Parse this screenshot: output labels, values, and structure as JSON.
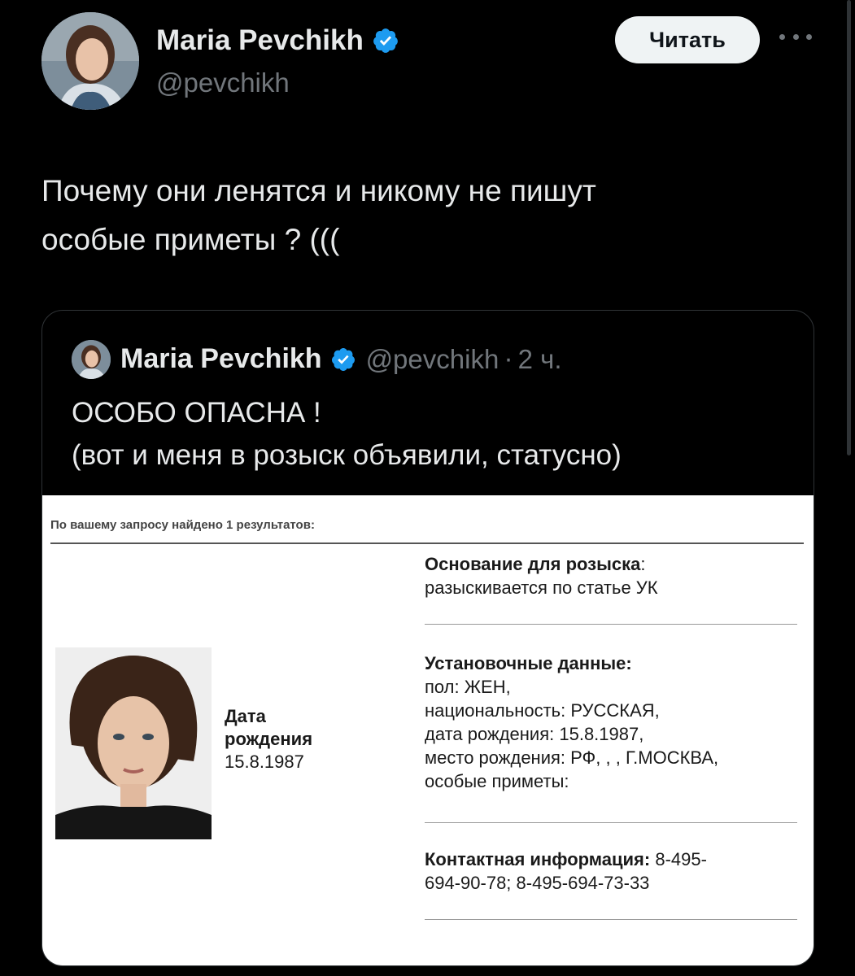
{
  "tweet": {
    "author_name": "Maria Pevchikh",
    "author_handle": "@pevchikh",
    "follow_label": "Читать",
    "text": "Почему они ленятся и никому не пишут\nособые приметы ? (((",
    "icons": {
      "verified": "verified-badge-icon",
      "more": "more-dots-icon"
    },
    "colors": {
      "verified_blue": "#1d9bf0",
      "background": "#000000",
      "secondary_text": "#71767b"
    }
  },
  "quote": {
    "author_name": "Maria Pevchikh",
    "author_handle": "@pevchikh",
    "separator": "·",
    "time": "2 ч.",
    "text": "ОСОБО ОПАСНА !\n(вот и меня в розыск объявили, статусно)",
    "document": {
      "results_line": "По вашему запросу найдено 1 результатов:",
      "dob_label": "Дата\nрождения",
      "dob_value": "15.8.1987",
      "reason_label": "Основание для розыска",
      "reason_colon": ":",
      "reason_value": "разыскивается по статье УК",
      "personal_label": "Установочные данные:",
      "personal_value": "пол: ЖЕН,\nнациональность: РУССКАЯ,\nдата рождения: 15.8.1987,\nместо рождения: РФ, , , Г.МОСКВА,\nособые приметы:",
      "contact_label": "Контактная информация:",
      "contact_value": " 8-495-\n694-90-78; 8-495-694-73-33"
    }
  }
}
